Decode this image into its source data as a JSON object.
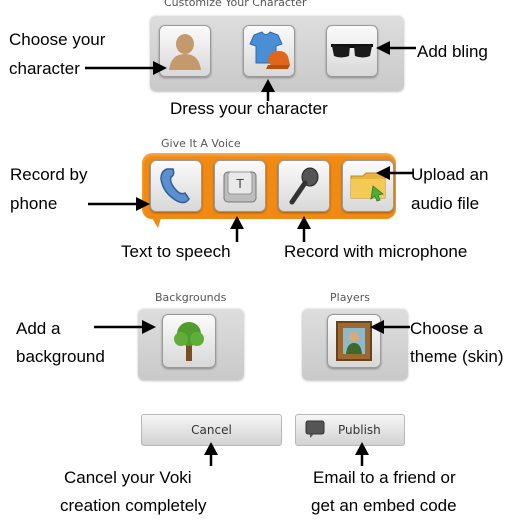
{
  "customize": {
    "title": "Customize Your Character",
    "annotations": {
      "choose": "Choose your character",
      "dress": "Dress your character",
      "bling": "Add bling"
    },
    "choose_line1": "Choose your",
    "choose_line2": "character"
  },
  "voice": {
    "title": "Give It A Voice",
    "record_phone_line1": "Record by",
    "record_phone_line2": "phone",
    "upload_line1": "Upload an",
    "upload_line2": "audio file",
    "tts": "Text to speech",
    "mic": "Record with microphone",
    "tts_key_glyph": "T"
  },
  "backgrounds": {
    "title": "Backgrounds",
    "ann_line1": "Add a",
    "ann_line2": "background"
  },
  "players": {
    "title": "Players",
    "ann_line1": "Choose a",
    "ann_line2": "theme (skin)"
  },
  "actions": {
    "cancel_label": "Cancel",
    "publish_label": "Publish",
    "cancel_ann_line1": "Cancel your Voki",
    "cancel_ann_line2": "creation completely",
    "publish_ann_line1": "Email to a friend or",
    "publish_ann_line2": "get an embed code"
  },
  "colors": {
    "voice_orange": "#f08a12",
    "panel_gray": "#d4d4d4"
  }
}
